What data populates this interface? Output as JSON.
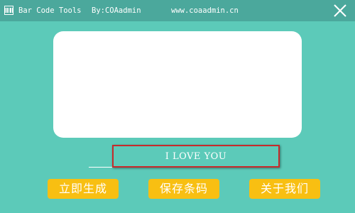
{
  "titlebar": {
    "app_name": "Bar Code Tools",
    "author": "By:COAadmin",
    "website": "www.coaadmin.cn",
    "app_icon": "barcode-icon",
    "close_icon": "close-icon"
  },
  "main": {
    "barcode_preview": "",
    "input_value": "I LOVE YOU",
    "highlight_color": "#c62b2b"
  },
  "buttons": {
    "generate_label": "立即生成",
    "save_label": "保存条码",
    "about_label": "关于我们"
  },
  "colors": {
    "background": "#5ccab9",
    "titlebar": "#4ba89c",
    "button": "#f8bf12"
  }
}
